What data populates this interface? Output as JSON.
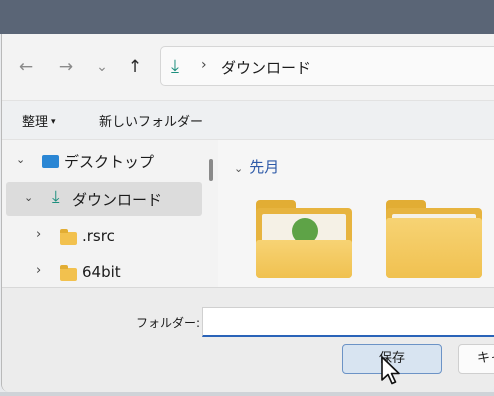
{
  "nav": {
    "back_glyph": "←",
    "forward_glyph": "→",
    "recent_glyph": "⌄",
    "up_glyph": "↑",
    "address": {
      "icon_glyph": "⤓",
      "separator": "›",
      "location": "ダウンロード"
    }
  },
  "commands": {
    "organize": "整理",
    "organize_caret": "▾",
    "new_folder": "新しいフォルダー"
  },
  "tree": {
    "items": [
      {
        "label": "デスクトップ",
        "twisty": "⌄"
      },
      {
        "label": "ダウンロード",
        "twisty": "⌄",
        "icon_glyph": "⤓"
      },
      {
        "label": ".rsrc",
        "twisty": "›"
      },
      {
        "label": "64bit",
        "twisty": "›"
      }
    ]
  },
  "content": {
    "group_chevron": "⌄",
    "group_label": "先月"
  },
  "form": {
    "folder_label": "フォルダー:",
    "folder_value": ""
  },
  "buttons": {
    "save": "保存",
    "cancel": "キャンセル"
  },
  "colors": {
    "accent": "#2a63b8",
    "download_icon": "#1e8f7e",
    "folder": "#f2c14e",
    "title_bar": "#5a6576"
  }
}
